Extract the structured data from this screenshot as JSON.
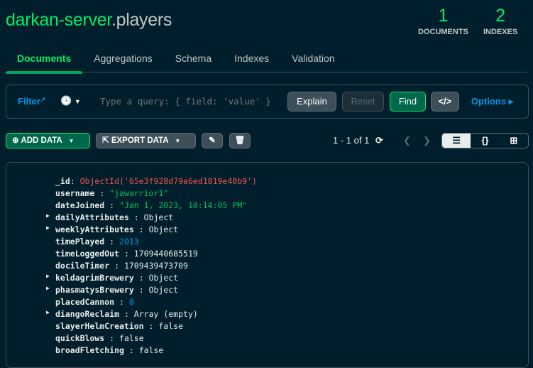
{
  "header": {
    "db": "darkan-server",
    "collection": ".players",
    "documents_count": "1",
    "documents_label": "DOCUMENTS",
    "indexes_count": "2",
    "indexes_label": "INDEXES"
  },
  "tabs": [
    "Documents",
    "Aggregations",
    "Schema",
    "Indexes",
    "Validation"
  ],
  "query": {
    "filter_label": "Filter",
    "placeholder": "Type a query: { field: 'value' }",
    "explain": "Explain",
    "reset": "Reset",
    "find": "Find",
    "code": "</>",
    "options": "Options ▸"
  },
  "toolbar": {
    "add_data": "ADD DATA",
    "export_data": "EXPORT DATA",
    "pagination": "1 - 1 of 1"
  },
  "document": [
    {
      "key": "_id",
      "value": "ObjectId('65e3f928d79a6ed1819e40b9')",
      "type": "oid",
      "expandable": false
    },
    {
      "key": "username",
      "value": "\"jawarrior1\"",
      "type": "str",
      "expandable": false
    },
    {
      "key": "dateJoined",
      "value": "\"Jan 1, 2023, 10:14:05 PM\"",
      "type": "str",
      "expandable": false
    },
    {
      "key": "dailyAttributes",
      "value": "Object",
      "type": "plain",
      "expandable": true
    },
    {
      "key": "weeklyAttributes",
      "value": "Object",
      "type": "plain",
      "expandable": true
    },
    {
      "key": "timePlayed",
      "value": "2013",
      "type": "num",
      "expandable": false
    },
    {
      "key": "timeLoggedOut",
      "value": "1709440685519",
      "type": "plain",
      "expandable": false
    },
    {
      "key": "docileTimer",
      "value": "1709439473709",
      "type": "plain",
      "expandable": false
    },
    {
      "key": "keldagrimBrewery",
      "value": "Object",
      "type": "plain",
      "expandable": true
    },
    {
      "key": "phasmatysBrewery",
      "value": "Object",
      "type": "plain",
      "expandable": true
    },
    {
      "key": "placedCannon",
      "value": "0",
      "type": "num",
      "expandable": false
    },
    {
      "key": "diangoReclaim",
      "value": "Array (empty)",
      "type": "plain",
      "expandable": true
    },
    {
      "key": "slayerHelmCreation",
      "value": "false",
      "type": "plain",
      "expandable": false
    },
    {
      "key": "quickBlows",
      "value": "false",
      "type": "plain",
      "expandable": false
    },
    {
      "key": "broadFletching",
      "value": "false",
      "type": "plain",
      "expandable": false
    }
  ]
}
